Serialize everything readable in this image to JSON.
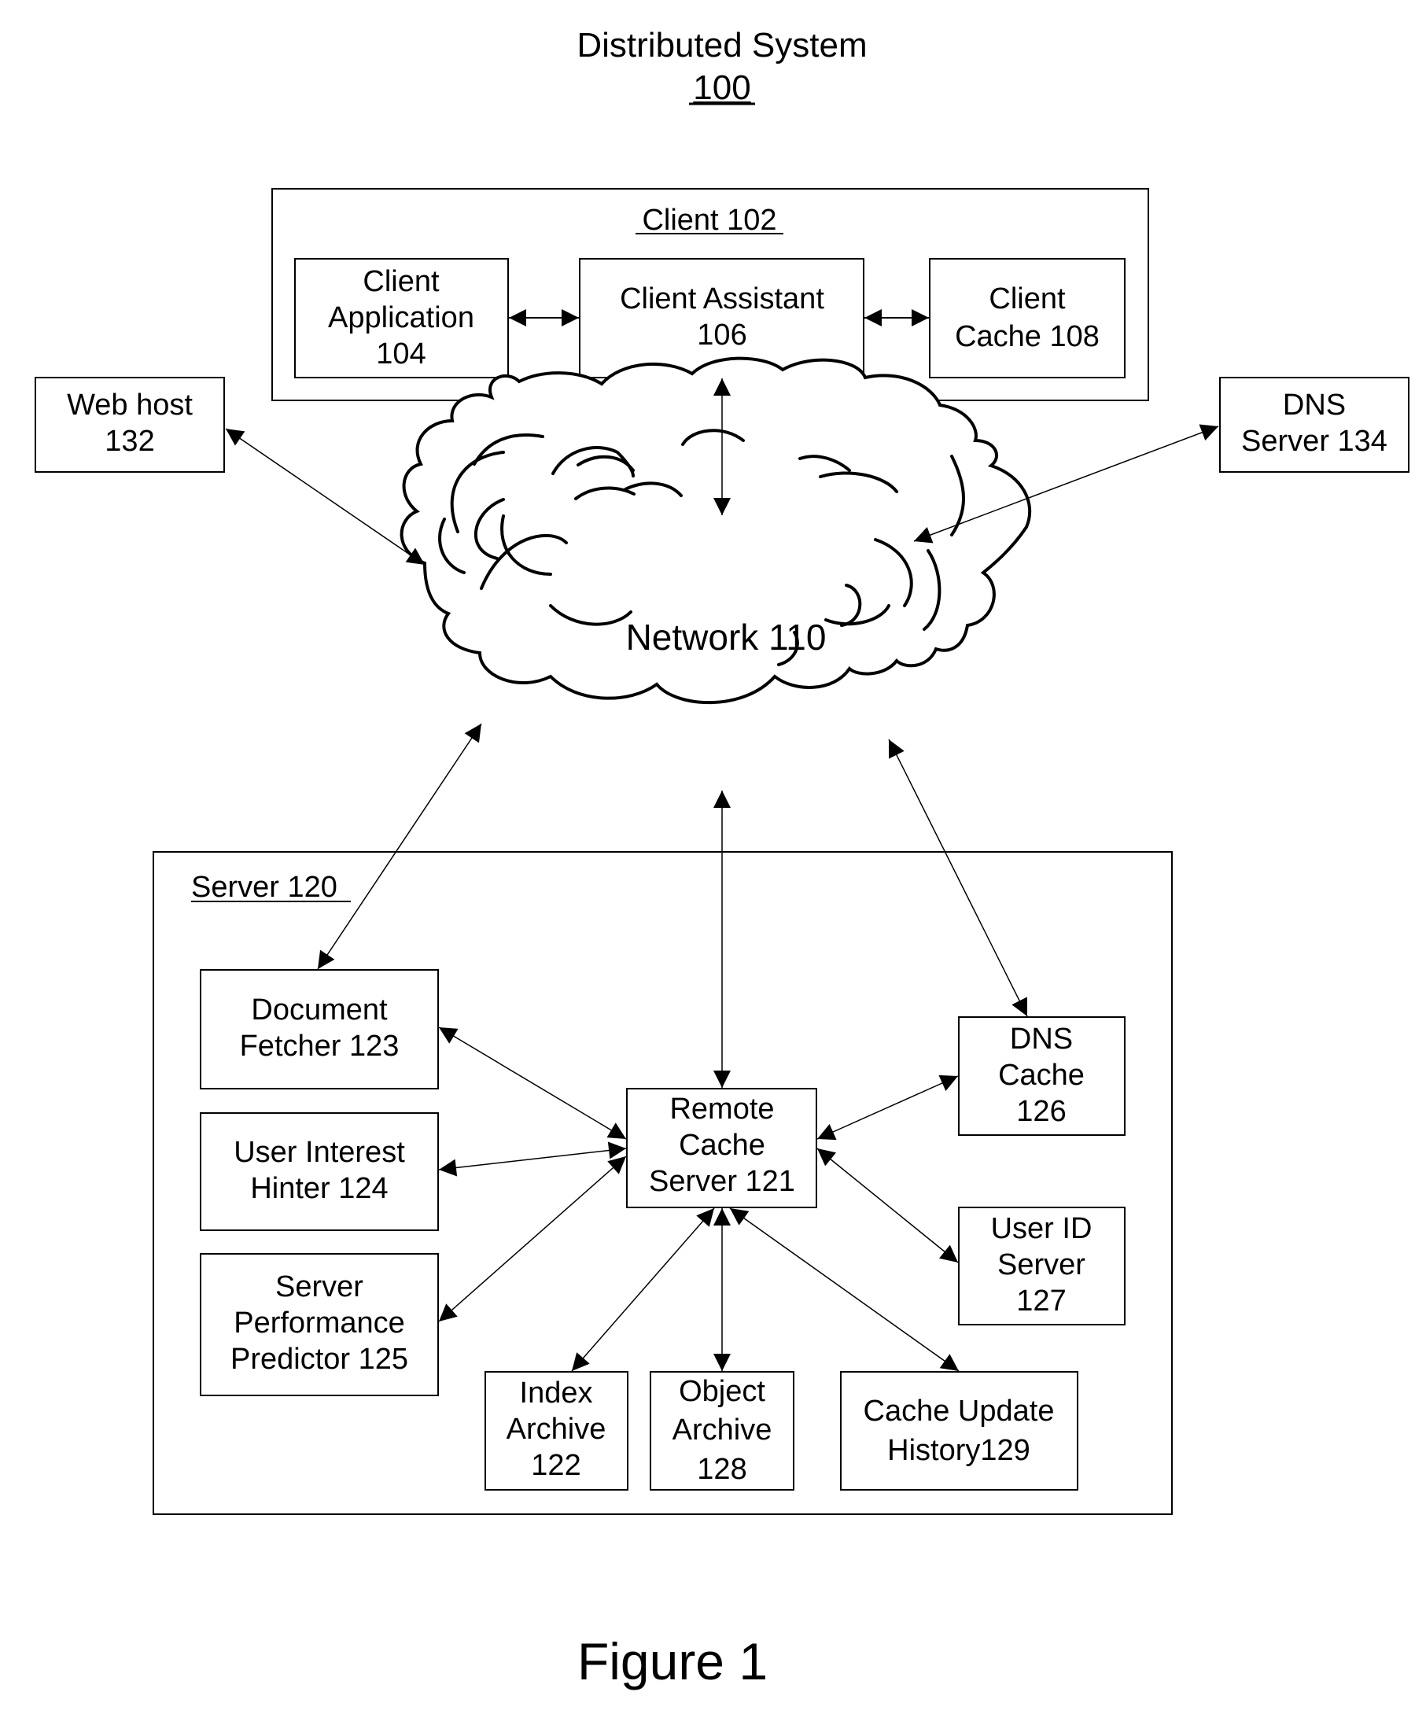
{
  "title": {
    "line1": "Distributed System",
    "line2": "100"
  },
  "figure_caption": "Figure 1",
  "network": {
    "label": "Network 110"
  },
  "client": {
    "label": "Client 102",
    "boxes": [
      {
        "id": "client-application",
        "lines": [
          "Client",
          "Application",
          "104"
        ]
      },
      {
        "id": "client-assistant",
        "lines": [
          "Client Assistant",
          "106"
        ]
      },
      {
        "id": "client-cache",
        "lines": [
          "Client",
          "Cache 108"
        ]
      }
    ]
  },
  "external": [
    {
      "id": "web-host",
      "lines": [
        "Web host",
        "132"
      ]
    },
    {
      "id": "dns-server",
      "lines": [
        "DNS",
        "Server 134"
      ]
    }
  ],
  "server": {
    "label": "Server 120",
    "boxes": [
      {
        "id": "document-fetcher",
        "lines": [
          "Document",
          "Fetcher 123"
        ]
      },
      {
        "id": "user-interest-hinter",
        "lines": [
          "User Interest",
          "Hinter 124"
        ]
      },
      {
        "id": "server-performance-predictor",
        "lines": [
          "Server",
          "Performance",
          "Predictor 125"
        ]
      },
      {
        "id": "remote-cache-server",
        "lines": [
          "Remote",
          "Cache",
          "Server 121"
        ]
      },
      {
        "id": "dns-cache",
        "lines": [
          "DNS",
          "Cache",
          "126"
        ]
      },
      {
        "id": "user-id-server",
        "lines": [
          "User ID",
          "Server",
          "127"
        ]
      },
      {
        "id": "index-archive",
        "lines": [
          "Index",
          "Archive",
          "122"
        ]
      },
      {
        "id": "object-archive",
        "lines": [
          "Object",
          "Archive",
          "128"
        ]
      },
      {
        "id": "cache-update-history",
        "lines": [
          "Cache Update",
          "History129"
        ]
      }
    ]
  },
  "connections": [
    {
      "from": "client-application",
      "to": "client-assistant",
      "type": "bidirectional"
    },
    {
      "from": "client-assistant",
      "to": "client-cache",
      "type": "bidirectional"
    },
    {
      "from": "client-assistant",
      "to": "network",
      "type": "bidirectional"
    },
    {
      "from": "web-host",
      "to": "network",
      "type": "bidirectional"
    },
    {
      "from": "dns-server",
      "to": "network",
      "type": "bidirectional"
    },
    {
      "from": "network",
      "to": "document-fetcher",
      "type": "bidirectional"
    },
    {
      "from": "network",
      "to": "remote-cache-server",
      "type": "bidirectional"
    },
    {
      "from": "network",
      "to": "dns-cache",
      "type": "bidirectional"
    },
    {
      "from": "remote-cache-server",
      "to": "document-fetcher",
      "type": "bidirectional"
    },
    {
      "from": "remote-cache-server",
      "to": "user-interest-hinter",
      "type": "bidirectional"
    },
    {
      "from": "remote-cache-server",
      "to": "server-performance-predictor",
      "type": "bidirectional"
    },
    {
      "from": "remote-cache-server",
      "to": "dns-cache",
      "type": "bidirectional"
    },
    {
      "from": "remote-cache-server",
      "to": "user-id-server",
      "type": "bidirectional"
    },
    {
      "from": "remote-cache-server",
      "to": "index-archive",
      "type": "bidirectional"
    },
    {
      "from": "remote-cache-server",
      "to": "object-archive",
      "type": "bidirectional"
    },
    {
      "from": "remote-cache-server",
      "to": "cache-update-history",
      "type": "bidirectional"
    }
  ]
}
